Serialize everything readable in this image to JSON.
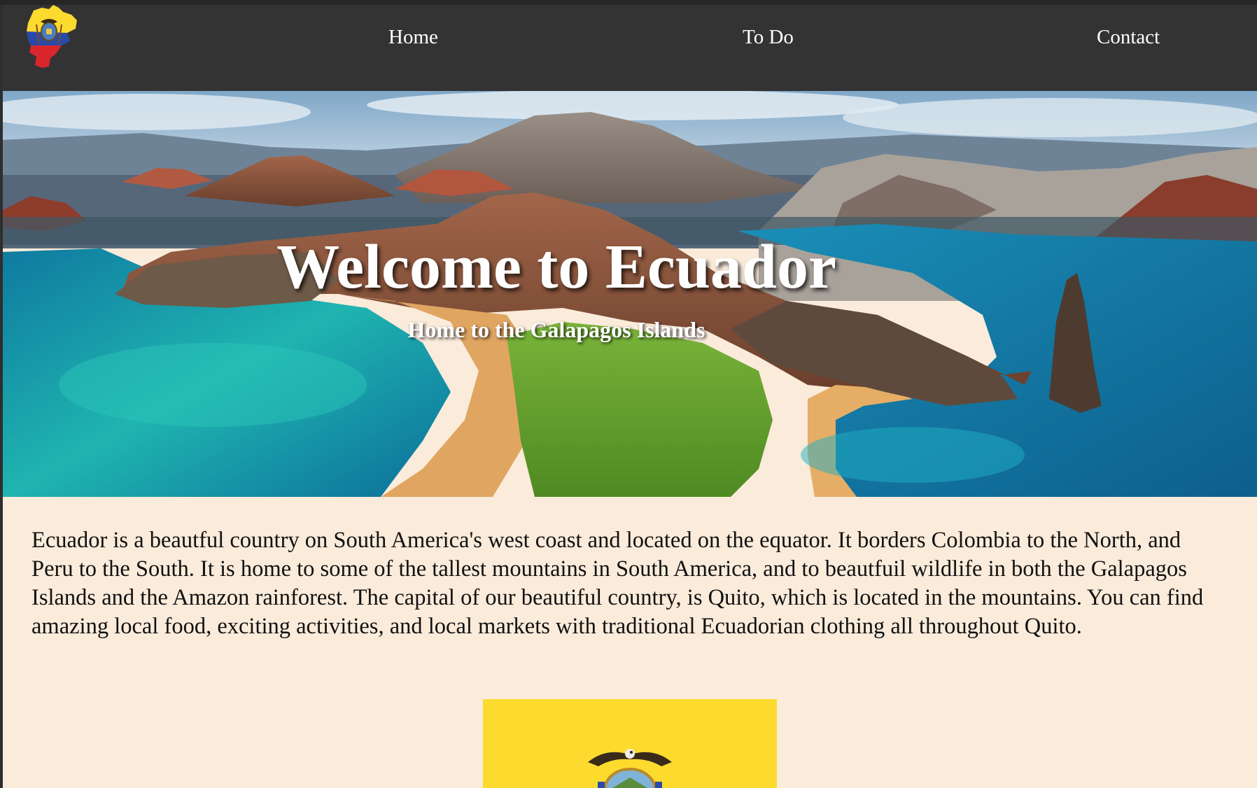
{
  "nav": {
    "logo_name": "ecuador-map-flag-logo",
    "links": [
      {
        "label": "Home"
      },
      {
        "label": "To Do"
      },
      {
        "label": "Contact"
      }
    ]
  },
  "hero": {
    "title": "Welcome to Ecuador",
    "subtitle": "Home to the Galapagos Islands"
  },
  "intro": {
    "text": "Ecuador is a beautful country on South America's west coast and located on the equator. It borders Colombia to the North, and Peru to the South. It is home to some of the tallest mountains in South America, and to beautfuil wildlife in both the Galapagos Islands and the Amazon rainforest. The capital of our beautiful country, is Quito, which is located in the mountains. You can find amazing local food, exciting activities, and local markets with traditional Ecuadorian clothing all throughout Quito."
  },
  "colors": {
    "nav_bg": "#333333",
    "page_bg": "#faebda",
    "flag_yellow": "#fcdb2e",
    "flag_blue": "#2a4aa8",
    "flag_red": "#d8262c"
  }
}
